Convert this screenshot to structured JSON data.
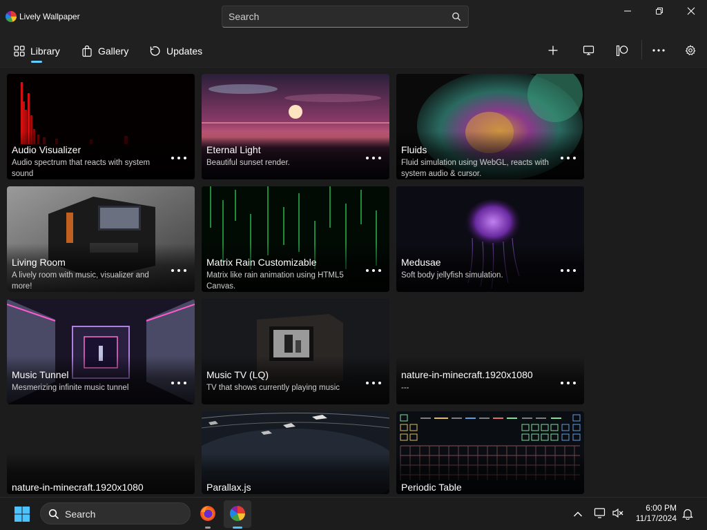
{
  "app": {
    "title": "Lively Wallpaper"
  },
  "search": {
    "placeholder": "Search"
  },
  "nav": {
    "items": [
      {
        "label": "Library"
      },
      {
        "label": "Gallery"
      },
      {
        "label": "Updates"
      }
    ]
  },
  "colors": {
    "accent": "#60cdff",
    "background": "#1c1c1c",
    "titlebar": "#202020"
  },
  "icons": {
    "titlebar": [
      "app-logo-icon",
      "search-icon",
      "minimize-icon",
      "restore-icon",
      "close-icon"
    ],
    "nav": [
      "grid-icon",
      "shopping-bag-icon",
      "refresh-icon"
    ],
    "toolbar": [
      "plus-icon",
      "monitor-icon",
      "patreon-icon",
      "more-icon",
      "gear-icon"
    ]
  },
  "wallpapers": [
    {
      "title": "Audio Visualizer",
      "description": "Audio spectrum that reacts with system sound"
    },
    {
      "title": "Eternal Light",
      "description": "Beautiful sunset render."
    },
    {
      "title": "Fluids",
      "description": "Fluid simulation using WebGL, reacts with system audio & cursor."
    },
    {
      "title": "Living Room",
      "description": "A lively room with music, visualizer and more!"
    },
    {
      "title": "Matrix Rain Customizable",
      "description": "Matrix like rain animation using HTML5 Canvas."
    },
    {
      "title": "Medusae",
      "description": "Soft body jellyfish simulation."
    },
    {
      "title": "Music Tunnel",
      "description": "Mesmerizing infinite music tunnel"
    },
    {
      "title": "Music TV (LQ)",
      "description": "TV that shows currently playing music"
    },
    {
      "title": "nature-in-minecraft.1920x1080",
      "description": "---"
    },
    {
      "title": "nature-in-minecraft.1920x1080",
      "description": ""
    },
    {
      "title": "Parallax.js",
      "description": ""
    },
    {
      "title": "Periodic Table",
      "description": ""
    }
  ],
  "taskbar": {
    "search_label": "Search",
    "time": "6:00 PM",
    "date": "11/17/2024",
    "icons": [
      "windows-start-icon",
      "search-icon",
      "firefox-icon",
      "lively-wallpaper-icon",
      "chevron-up-icon",
      "display-icon",
      "volume-muted-icon",
      "notification-bell-icon"
    ]
  }
}
